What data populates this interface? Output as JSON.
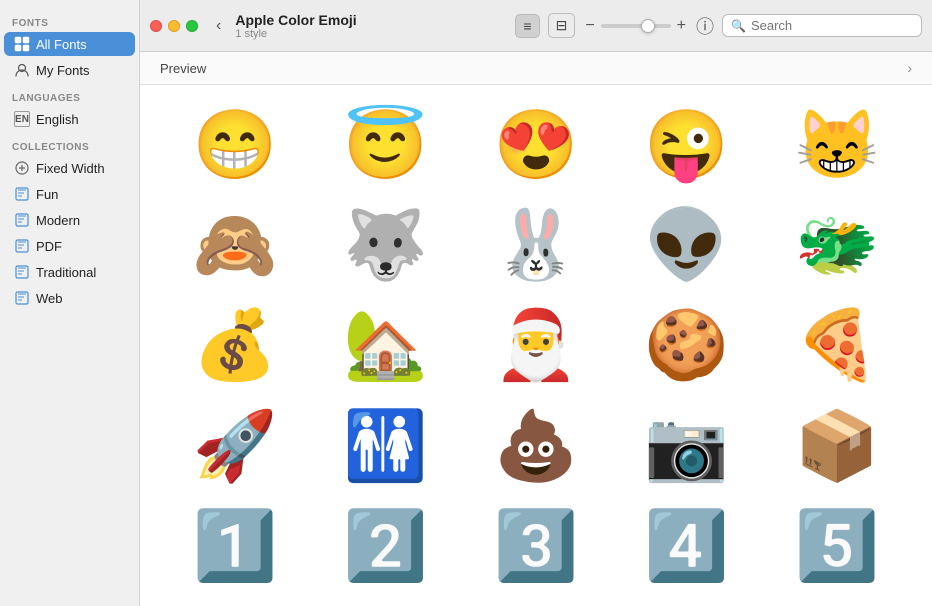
{
  "window": {
    "title": "Apple Color Emoji",
    "subtitle": "1 style",
    "controls": {
      "close": "close",
      "minimize": "minimize",
      "maximize": "maximize"
    }
  },
  "sidebar": {
    "fonts_label": "Fonts",
    "fonts_items": [
      {
        "id": "all-fonts",
        "label": "All Fonts",
        "icon": "⊞",
        "active": true
      },
      {
        "id": "my-fonts",
        "label": "My Fonts",
        "icon": "👤",
        "active": false
      }
    ],
    "languages_label": "Languages",
    "languages_items": [
      {
        "id": "english",
        "label": "English",
        "icon": "EN",
        "active": false
      }
    ],
    "collections_label": "Collections",
    "collections_items": [
      {
        "id": "fixed-width",
        "label": "Fixed Width",
        "icon": "⚙",
        "active": false
      },
      {
        "id": "fun",
        "label": "Fun",
        "icon": "📄",
        "active": false
      },
      {
        "id": "modern",
        "label": "Modern",
        "icon": "📄",
        "active": false
      },
      {
        "id": "pdf",
        "label": "PDF",
        "icon": "📄",
        "active": false
      },
      {
        "id": "traditional",
        "label": "Traditional",
        "icon": "📄",
        "active": false
      },
      {
        "id": "web",
        "label": "Web",
        "icon": "📄",
        "active": false
      }
    ]
  },
  "toolbar": {
    "back_label": "‹",
    "list_view_label": "≡",
    "grid_view_label": "⊟",
    "size_minus": "−",
    "size_plus": "+",
    "info_label": "ⓘ",
    "search_placeholder": "Search"
  },
  "preview": {
    "label": "Preview",
    "chevron": "›"
  },
  "emoji_grid": [
    "😁",
    "😇",
    "😍",
    "😜",
    "😸",
    "🙈",
    "🐺",
    "🐰",
    "👽",
    "🐲",
    "💰",
    "🏡",
    "🎅",
    "🍪",
    "🍕",
    "🚀",
    "🚻",
    "💩",
    "📷",
    "📦",
    "1️⃣",
    "2️⃣",
    "3️⃣",
    "4️⃣",
    "5️⃣"
  ]
}
